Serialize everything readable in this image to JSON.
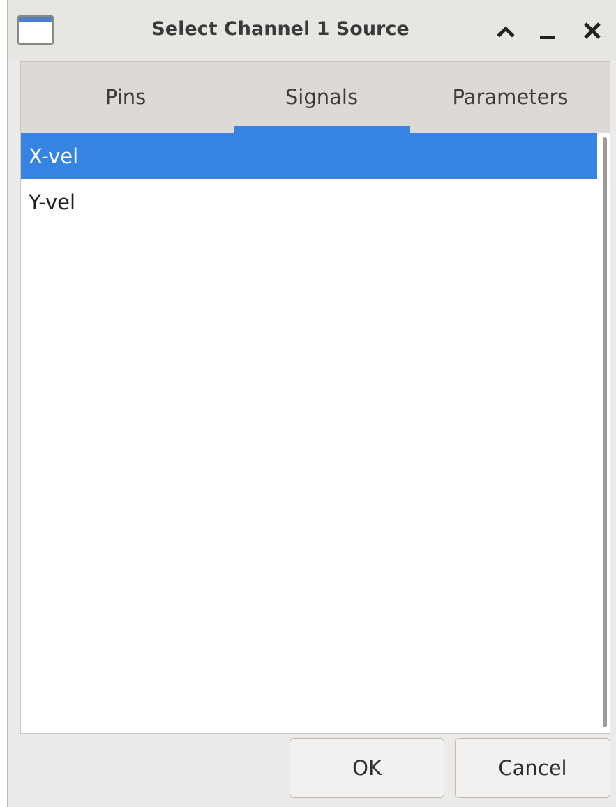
{
  "window": {
    "title": "Select Channel 1 Source"
  },
  "titlebar": {
    "buttons": [
      "chevron-up-icon",
      "minimize-icon",
      "close-icon"
    ]
  },
  "tabs": [
    {
      "label": "Pins",
      "active": false
    },
    {
      "label": "Signals",
      "active": true
    },
    {
      "label": "Parameters",
      "active": false
    }
  ],
  "list": {
    "items": [
      {
        "label": "X-vel",
        "selected": true
      },
      {
        "label": "Y-vel",
        "selected": false
      }
    ]
  },
  "buttons": {
    "ok_label": "OK",
    "cancel_label": "Cancel"
  },
  "colors": {
    "accent": "#3584e4",
    "window_bg": "#edebe9",
    "tabbar_bg": "#dcd9d6"
  }
}
